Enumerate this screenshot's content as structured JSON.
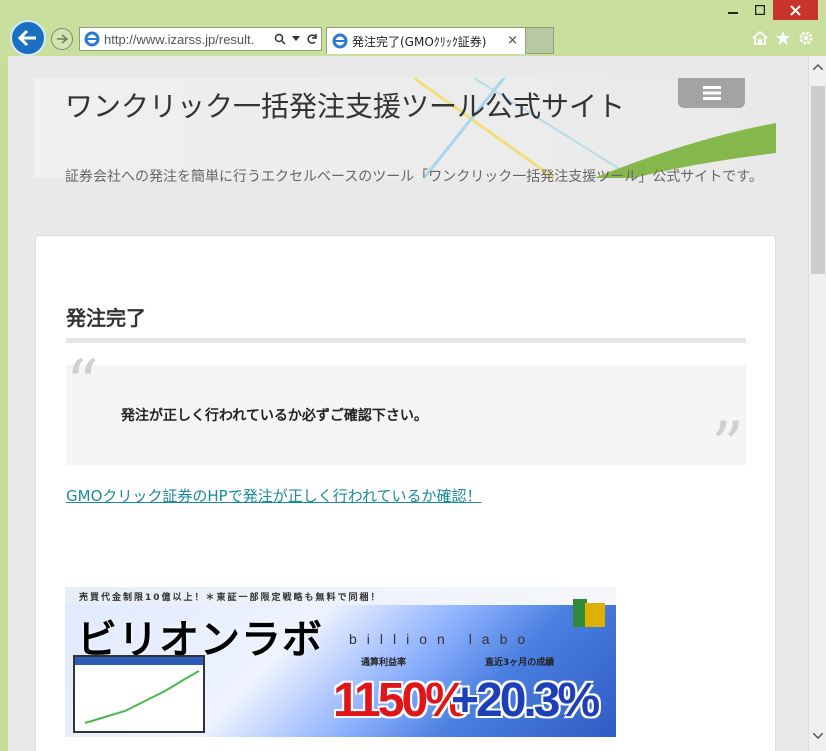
{
  "browser": {
    "url": "http://www.izarss.jp/result.",
    "tab_title": "発注完了(GMOｸﾘｯｸ証券)",
    "tab_close": "×",
    "menu_icon": "hamburger-icon"
  },
  "site": {
    "title": "ワンクリック一括発注支援ツール公式サイト",
    "description": "証券会社への発注を簡単に行うエクセルベースのツール「ワンクリック一括発注支援ツール」公式サイトです。"
  },
  "post": {
    "title": "発注完了",
    "quote": "発注が正しく行われているか必ずご確認下さい。",
    "link": "GMOクリック証券のHPで発注が正しく行われているか確認！"
  },
  "banner": {
    "tagline": "売買代金制限10億以上！＊東証一部限定戦略も無料で同梱！",
    "brand_jp": "ビリオンラボ",
    "brand_en": "billion labo",
    "label_total": "通算利益率",
    "label_recent": "直近3ヶ月の成績",
    "value_total": "1150%",
    "value_recent": "+20.3%"
  },
  "colors": {
    "chrome": "#c9df9e",
    "link": "#1b8a9c",
    "close": "#c7352a"
  }
}
